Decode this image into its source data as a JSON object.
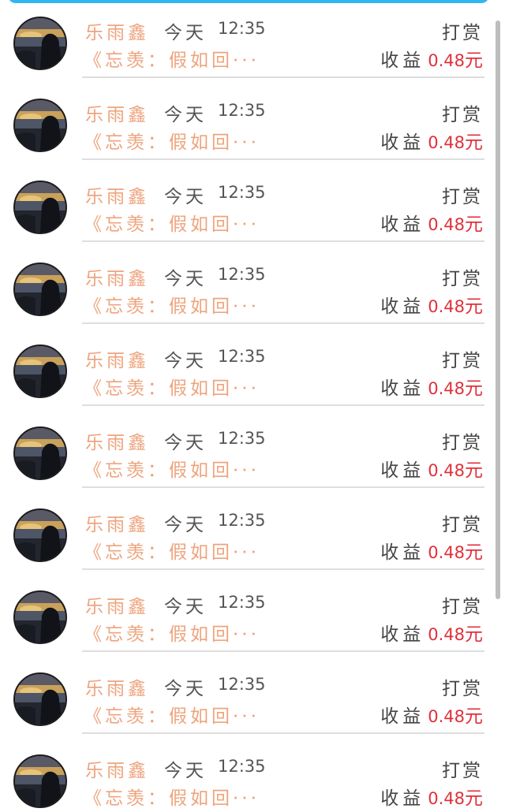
{
  "colors": {
    "accent_top_bar": "#31b6f0",
    "name_text": "#eea47e",
    "amount_red": "#e0303b"
  },
  "rows": [
    {
      "avatar_icon": "user-avatar-photo",
      "name": "乐雨鑫",
      "day": "今天",
      "time": "12:35",
      "preview": "《忘羡：假如回···",
      "type": "打赏",
      "earn_label": "收益",
      "amount": "0.48",
      "unit": "元"
    },
    {
      "avatar_icon": "user-avatar-photo",
      "name": "乐雨鑫",
      "day": "今天",
      "time": "12:35",
      "preview": "《忘羡：假如回···",
      "type": "打赏",
      "earn_label": "收益",
      "amount": "0.48",
      "unit": "元"
    },
    {
      "avatar_icon": "user-avatar-photo",
      "name": "乐雨鑫",
      "day": "今天",
      "time": "12:35",
      "preview": "《忘羡：假如回···",
      "type": "打赏",
      "earn_label": "收益",
      "amount": "0.48",
      "unit": "元"
    },
    {
      "avatar_icon": "user-avatar-photo",
      "name": "乐雨鑫",
      "day": "今天",
      "time": "12:35",
      "preview": "《忘羡：假如回···",
      "type": "打赏",
      "earn_label": "收益",
      "amount": "0.48",
      "unit": "元"
    },
    {
      "avatar_icon": "user-avatar-photo",
      "name": "乐雨鑫",
      "day": "今天",
      "time": "12:35",
      "preview": "《忘羡：假如回···",
      "type": "打赏",
      "earn_label": "收益",
      "amount": "0.48",
      "unit": "元"
    },
    {
      "avatar_icon": "user-avatar-photo",
      "name": "乐雨鑫",
      "day": "今天",
      "time": "12:35",
      "preview": "《忘羡：假如回···",
      "type": "打赏",
      "earn_label": "收益",
      "amount": "0.48",
      "unit": "元"
    },
    {
      "avatar_icon": "user-avatar-photo",
      "name": "乐雨鑫",
      "day": "今天",
      "time": "12:35",
      "preview": "《忘羡：假如回···",
      "type": "打赏",
      "earn_label": "收益",
      "amount": "0.48",
      "unit": "元"
    },
    {
      "avatar_icon": "user-avatar-photo",
      "name": "乐雨鑫",
      "day": "今天",
      "time": "12:35",
      "preview": "《忘羡：假如回···",
      "type": "打赏",
      "earn_label": "收益",
      "amount": "0.48",
      "unit": "元"
    },
    {
      "avatar_icon": "user-avatar-photo",
      "name": "乐雨鑫",
      "day": "今天",
      "time": "12:35",
      "preview": "《忘羡：假如回···",
      "type": "打赏",
      "earn_label": "收益",
      "amount": "0.48",
      "unit": "元"
    },
    {
      "avatar_icon": "user-avatar-photo",
      "name": "乐雨鑫",
      "day": "今天",
      "time": "12:35",
      "preview": "《忘羡：假如回···",
      "type": "打赏",
      "earn_label": "收益",
      "amount": "0.48",
      "unit": "元"
    }
  ]
}
